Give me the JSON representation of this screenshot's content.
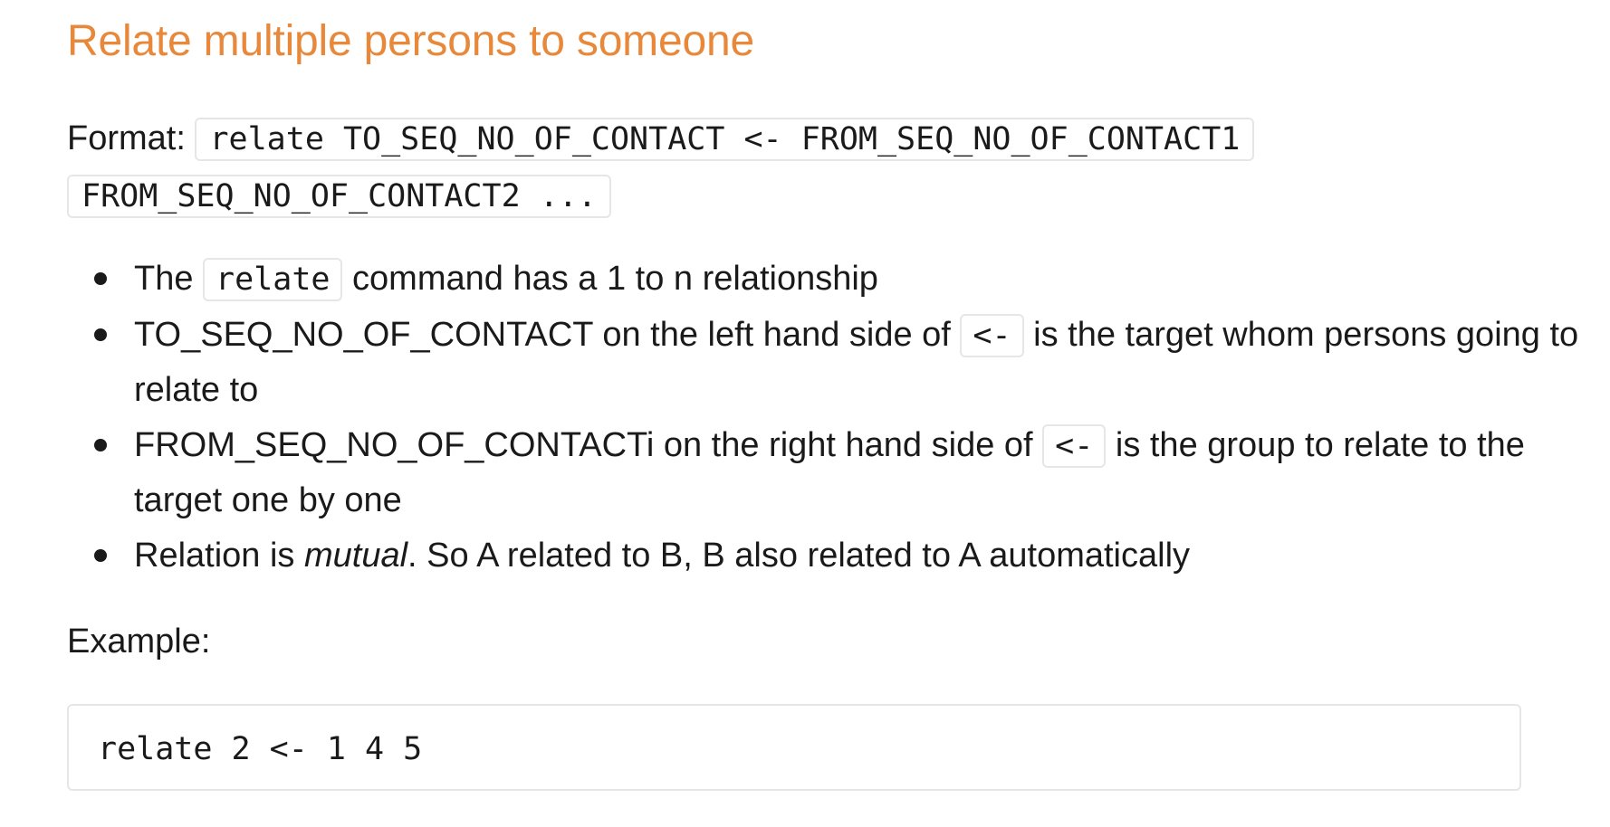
{
  "title": "Relate multiple persons to someone",
  "format": {
    "label": "Format:",
    "code": "relate TO_SEQ_NO_OF_CONTACT <- FROM_SEQ_NO_OF_CONTACT1 FROM_SEQ_NO_OF_CONTACT2 ..."
  },
  "bullets": [
    {
      "pre": "The",
      "code": "relate",
      "post": "command has a 1 to n relationship"
    },
    {
      "pre": "TO_SEQ_NO_OF_CONTACT on the left hand side of",
      "code": "<-",
      "post": "is the target whom persons going to relate to"
    },
    {
      "pre": "FROM_SEQ_NO_OF_CONTACTi on the right hand side of",
      "code": "<-",
      "post": "is the group to relate to the target one by one"
    },
    {
      "pre": "Relation is",
      "emphasis": "mutual",
      "post": ". So A related to B, B also related to A automatically"
    }
  ],
  "example": {
    "label": "Example:",
    "code": "relate 2 <- 1 4 5"
  }
}
